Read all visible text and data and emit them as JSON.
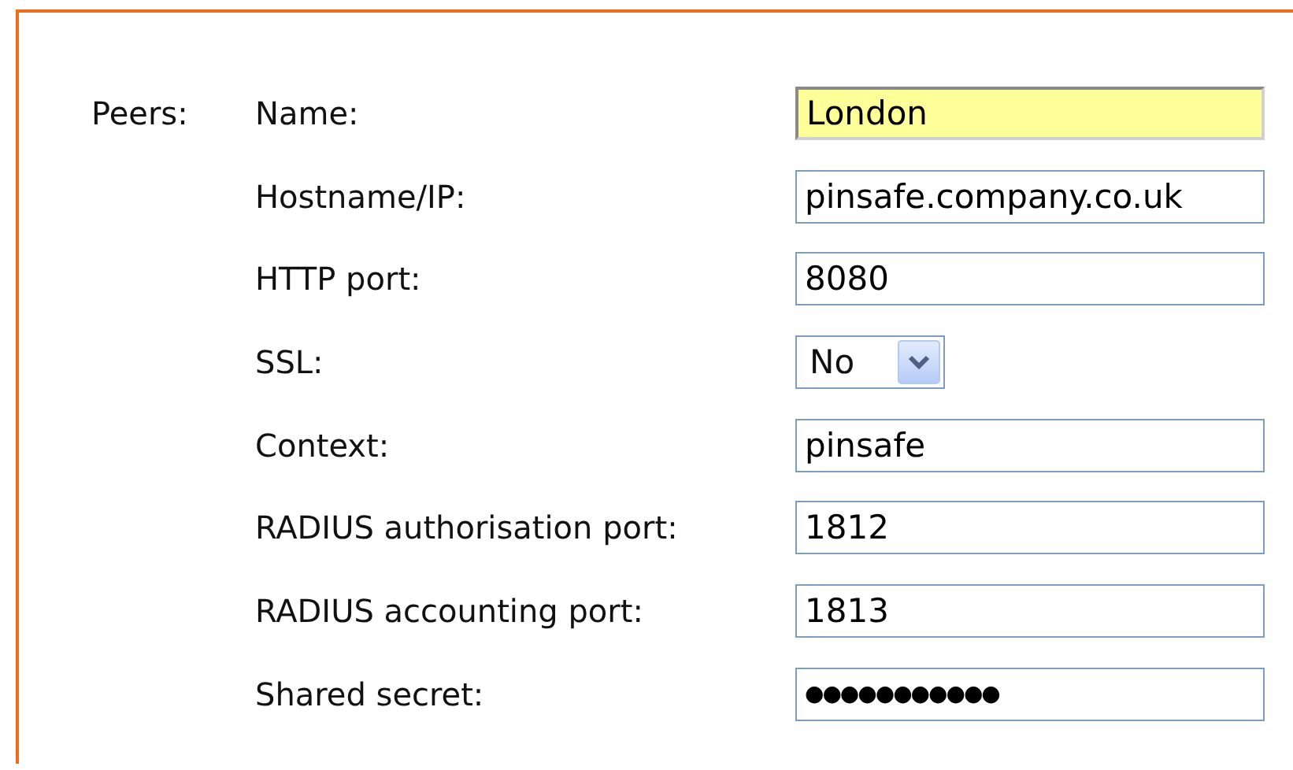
{
  "section_label": "Peers:",
  "fields": [
    {
      "label": "Name:",
      "kind": "text",
      "value": "London",
      "focused": true
    },
    {
      "label": "Hostname/IP:",
      "kind": "text",
      "value": "pinsafe.company.co.uk",
      "focused": false
    },
    {
      "label": "HTTP port:",
      "kind": "text",
      "value": "8080",
      "focused": false
    },
    {
      "label": "SSL:",
      "kind": "select",
      "value": "No",
      "focused": false
    },
    {
      "label": "Context:",
      "kind": "text",
      "value": "pinsafe",
      "focused": false
    },
    {
      "label": "RADIUS authorisation port:",
      "kind": "text",
      "value": "1812",
      "focused": false
    },
    {
      "label": "RADIUS accounting port:",
      "kind": "text",
      "value": "1813",
      "focused": false
    },
    {
      "label": "Shared secret:",
      "kind": "password",
      "value": "●●●●●●●●●●●",
      "focused": false
    }
  ]
}
